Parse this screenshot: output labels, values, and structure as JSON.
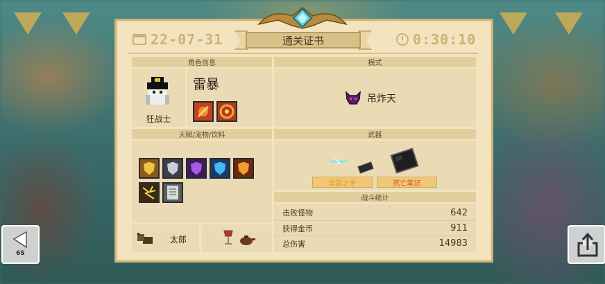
{
  "header": {
    "date": "22-07-31",
    "title": "通关证书",
    "timer": "0:30:10"
  },
  "character_section": {
    "heading": "角色信息",
    "class_name": "狂战士",
    "skin_name": "雷暴"
  },
  "mode_section": {
    "heading": "模式",
    "mode_name": "吊炸天"
  },
  "buffs_section": {
    "heading": "天赋/宠物/饮料",
    "pet_name": "太郎"
  },
  "weapons_section": {
    "heading": "武器",
    "weapons": [
      {
        "name": "雷霆之矛"
      },
      {
        "name": "死亡笔记"
      }
    ]
  },
  "stats_section": {
    "heading": "战斗统计",
    "rows": [
      {
        "label": "击败怪物",
        "value": "642"
      },
      {
        "label": "获得金币",
        "value": "911"
      },
      {
        "label": "总伤害",
        "value": "14983"
      }
    ]
  },
  "back_button": {
    "countdown": "6S"
  },
  "colors": {
    "paper": "#f3e4bf",
    "panel": "#eadbb5",
    "header": "#e2cf9e",
    "gold_text": "#cbb278",
    "weapon_tag": "#f0c878",
    "weapon_tag_text": "#d94a22"
  },
  "icons": {
    "back": "back-arrow-icon",
    "share": "share-icon",
    "calendar": "calendar-icon",
    "clock": "clock-icon",
    "mode": "demon-skull-icon"
  }
}
